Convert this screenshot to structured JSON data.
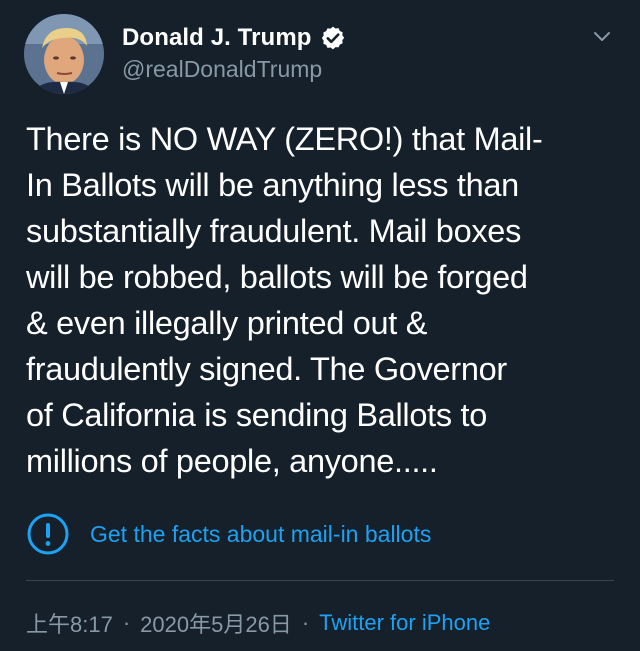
{
  "user": {
    "display_name": "Donald J. Trump",
    "handle": "@realDonaldTrump",
    "verified": true
  },
  "tweet": {
    "text": "There is NO WAY (ZERO!) that Mail-\nIn Ballots will be anything less than\nsubstantially fraudulent. Mail boxes\nwill be robbed, ballots will be forged\n& even illegally printed out &\nfraudulently signed. The Governor\nof California is sending Ballots to\nmillions of people, anyone.....",
    "fact_check_label": "Get the facts about mail-in ballots"
  },
  "meta": {
    "time": "上午8:17",
    "separator": "·",
    "date": "2020年5月26日",
    "source": "Twitter for iPhone"
  },
  "colors": {
    "background": "#15202b",
    "accent": "#1da1f2",
    "secondary_text": "#8899a6",
    "divider": "#38444d"
  },
  "icons": {
    "verified": "verified-badge-icon",
    "menu": "chevron-down-icon",
    "fact_check": "exclamation-circle-icon"
  }
}
